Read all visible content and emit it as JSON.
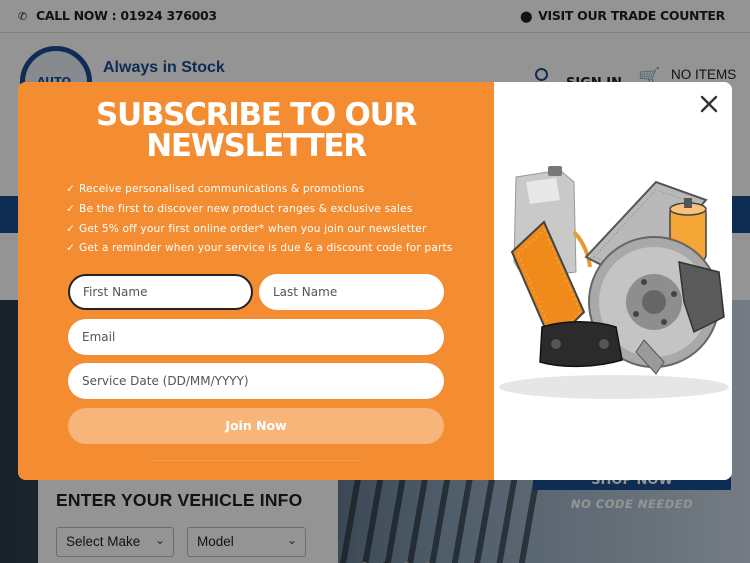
{
  "topbar": {
    "call_label": "CALL NOW : 01924 376003",
    "trade_label": "VISIT OUR TRADE COUNTER"
  },
  "header": {
    "logo_text": "AUTO",
    "tagline": "Always in Stock",
    "signin_label": "SIGN IN",
    "items_label": "NO ITEMS"
  },
  "vehicle_search": {
    "title": "ENTER YOUR VEHICLE INFO",
    "make_selected": "Select Make",
    "model_selected": "Model"
  },
  "hero": {
    "shop_now_label": "SHOP NOW",
    "no_code_label": "NO CODE NEEDED"
  },
  "popup": {
    "title_line1": "SUBSCRIBE TO OUR",
    "title_line2": "NEWSLETTER",
    "benefits": [
      "Receive personalised communications & promotions",
      "Be the first to discover new product ranges & exclusive sales",
      "Get 5% off your first online order* when you join our newsletter",
      "Get a reminder when your service is due & a discount code for parts"
    ],
    "first_name_placeholder": "First Name",
    "last_name_placeholder": "Last Name",
    "email_placeholder": "Email",
    "service_date_placeholder": "Service Date (DD/MM/YYYY)",
    "join_label": "Join Now",
    "close_icon": "close-icon",
    "image_icon": "car-parts-image"
  },
  "colors": {
    "brand_blue": "#1a4d8f",
    "popup_orange": "#f48c32",
    "join_button": "#f8b57a"
  }
}
